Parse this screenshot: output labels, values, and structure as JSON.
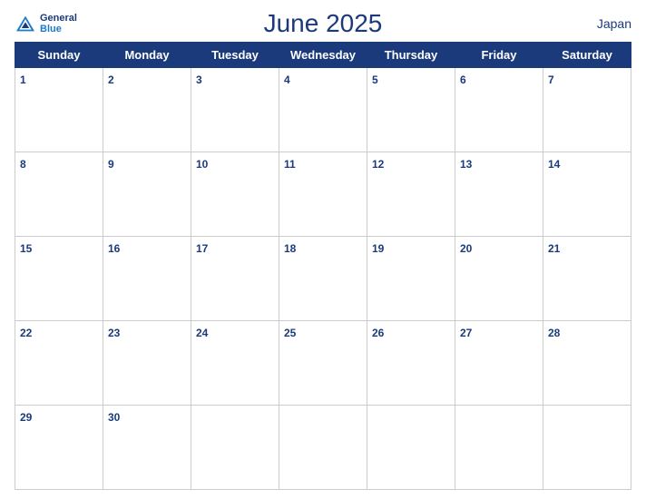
{
  "header": {
    "logo_general": "General",
    "logo_blue": "Blue",
    "month_title": "June 2025",
    "country": "Japan"
  },
  "weekdays": [
    "Sunday",
    "Monday",
    "Tuesday",
    "Wednesday",
    "Thursday",
    "Friday",
    "Saturday"
  ],
  "weeks": [
    [
      1,
      2,
      3,
      4,
      5,
      6,
      7
    ],
    [
      8,
      9,
      10,
      11,
      12,
      13,
      14
    ],
    [
      15,
      16,
      17,
      18,
      19,
      20,
      21
    ],
    [
      22,
      23,
      24,
      25,
      26,
      27,
      28
    ],
    [
      29,
      30,
      null,
      null,
      null,
      null,
      null
    ]
  ]
}
